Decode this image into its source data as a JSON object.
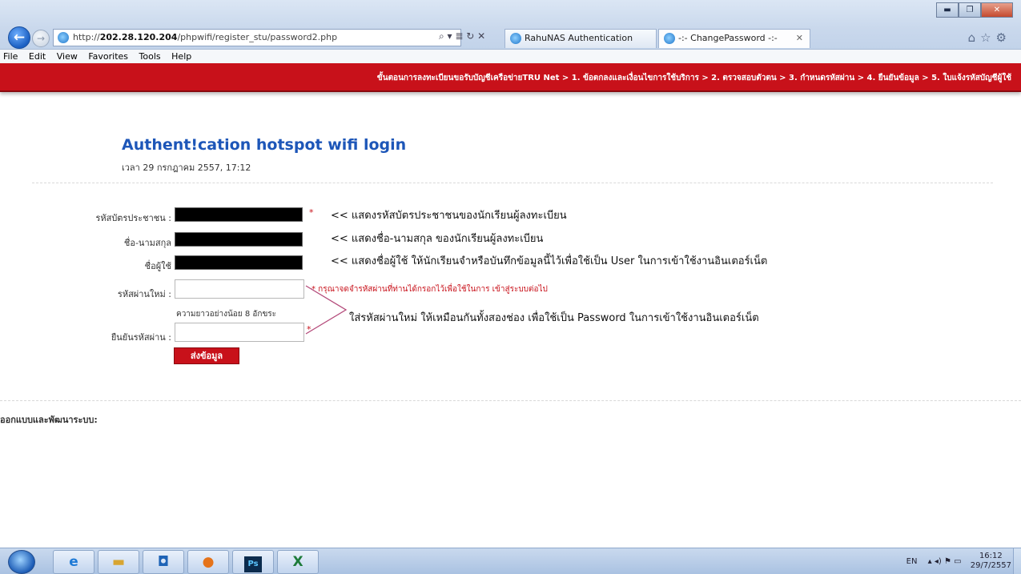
{
  "browser": {
    "url_prefix": "http://",
    "url_host": "202.28.120.204",
    "url_path": "/phpwifi/register_stu/password2.php",
    "addr_tools": "⌕ ▾ ≣ ↻ ✕",
    "tabs": [
      {
        "label": "RahuNAS Authentication"
      },
      {
        "label": "-:- ChangePassword -:-"
      }
    ],
    "tab_close": "✕",
    "window_controls": {
      "minimize": "▬",
      "maximize": "❐",
      "close": "✕"
    },
    "right_icons": "⌂☆⚙",
    "back": "←",
    "forward": "→"
  },
  "menu": [
    "File",
    "Edit",
    "View",
    "Favorites",
    "Tools",
    "Help"
  ],
  "steps_bar": "ขั้นตอนการลงทะเบียนขอรับบัญชีเครือข่ายTRU Net > 1. ข้อตกลงและเงื่อนไขการใช้บริการ > 2. ตรวจสอบตัวตน > 3. กำหนดรหัสผ่าน > 4. ยืนยันข้อมูล > 5. ใบแจ้งรหัสบัญชีผู้ใช้",
  "page": {
    "title": "Authent!cation hotspot wifi login",
    "timestamp": "เวลา 29 กรกฎาคม 2557, 17:12"
  },
  "form": {
    "id_label": "รหัสบัตรประชาชน :",
    "name_label": "ชื่อ-นามสกุล",
    "username_label": "ชื่อผู้ใช้",
    "new_password_label": "รหัสผ่านใหม่ :",
    "confirm_password_label": "ยืนยันรหัสผ่าน :",
    "required_mark": "*",
    "password_hint": "* กรุณาจดจำรหัสผ่านที่ท่านได้กรอกไว้เพื่อใช้ในการ เข้าสู่ระบบต่อไป",
    "min_length_hint": "ความยาวอย่างน้อย 8 อักขระ",
    "submit_label": "ส่งข้อมูล"
  },
  "annotations": {
    "id_note": "<< แสดงรหัสบัตรประชาชนของนักเรียนผู้ลงทะเบียน",
    "name_note": "<< แสดงชื่อ-นามสกุล ของนักเรียนผู้ลงทะเบียน",
    "username_note": "<< แสดงชื่อผู้ใช้ ให้นักเรียนจำหรือบันทึกข้อมูลนี้ไว้เพื่อใช้เป็น User ในการเข้าใช้งานอินเตอร์เน็ต",
    "password_note": "ใส่รหัสผ่านใหม่ ให้เหมือนกันทั้งสองช่อง เพื่อใช้เป็น Password ในการเข้าใช้งานอินเตอร์เน็ต"
  },
  "footer": "ออกแบบและพัฒนาระบบ:",
  "taskbar": {
    "items": [
      "ie-icon",
      "explorer-icon",
      "outlook-icon",
      "firefox-icon",
      "photoshop-icon",
      "excel-icon"
    ],
    "ps_label": "Ps",
    "lang": "EN",
    "tray_icons": "▴ ◂) ⚑ ▭",
    "time": "16:12",
    "date": "29/7/2557"
  },
  "colors": {
    "brand_red": "#c8111a",
    "title_blue": "#1d56b8"
  }
}
